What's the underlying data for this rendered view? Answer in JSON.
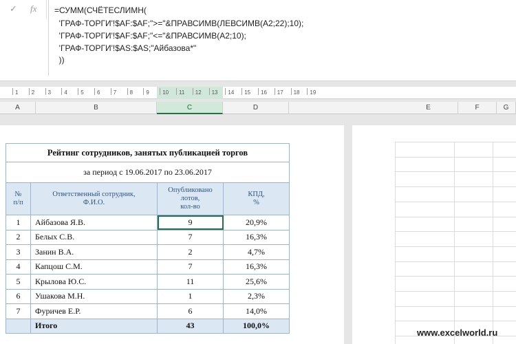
{
  "formula_bar": {
    "cancel_glyph": "✓",
    "fx_label": "fx",
    "lines": [
      "=СУММ(СЧЁТЕСЛИМН(",
      "  'ГРАФ-ТОРГИ'!$AF:$AF;\">=\"&ПРАВСИМВ(ЛЕВСИМВ(A2;22);10);",
      "  'ГРАФ-ТОРГИ'!$AF:$AF;\"<=\"&ПРАВСИМВ(A2;10);",
      "  'ГРАФ-ТОРГИ'!$AS:$AS;\"Айбазова*\"",
      "  ))"
    ]
  },
  "ruler": {
    "marks": [
      "1",
      "2",
      "3",
      "4",
      "5",
      "6",
      "7",
      "8",
      "9",
      "10",
      "11",
      "12",
      "13",
      "14",
      "15",
      "16",
      "17",
      "18",
      "19"
    ]
  },
  "columns": [
    "A",
    "B",
    "C",
    "D",
    "E",
    "F",
    "G"
  ],
  "selected_column": "C",
  "table": {
    "title": "Рейтинг сотрудников, занятых публикацией торгов",
    "period": "за период с 19.06.2017 по 23.06.2017",
    "headers": {
      "num": "№\nп/п",
      "employee": "Ответственный сотрудник,\nФ.И.О.",
      "published": "Опубликовано\nлотов,\nкол-во",
      "kpd": "КПД,\n%"
    },
    "rows": [
      {
        "n": "1",
        "name": "Айбазова Я.В.",
        "count": "9",
        "kpd": "20,9%"
      },
      {
        "n": "2",
        "name": "Белых С.В.",
        "count": "7",
        "kpd": "16,3%"
      },
      {
        "n": "3",
        "name": "Занин В.А.",
        "count": "2",
        "kpd": "4,7%"
      },
      {
        "n": "4",
        "name": "Капцош С.М.",
        "count": "7",
        "kpd": "16,3%"
      },
      {
        "n": "5",
        "name": "Крылова Ю.С.",
        "count": "11",
        "kpd": "25,6%"
      },
      {
        "n": "6",
        "name": "Ушакова М.Н.",
        "count": "1",
        "kpd": "2,3%"
      },
      {
        "n": "7",
        "name": "Фуричев Е.Р.",
        "count": "6",
        "kpd": "14,0%"
      }
    ],
    "total": {
      "label": "Итого",
      "count": "43",
      "kpd": "100,0%"
    }
  },
  "watermark": "www.excelworld.ru",
  "colors": {
    "accent": "#217346",
    "header_bg": "#dbe7f2",
    "header_text": "#34547a",
    "border": "#9fb4c8"
  }
}
